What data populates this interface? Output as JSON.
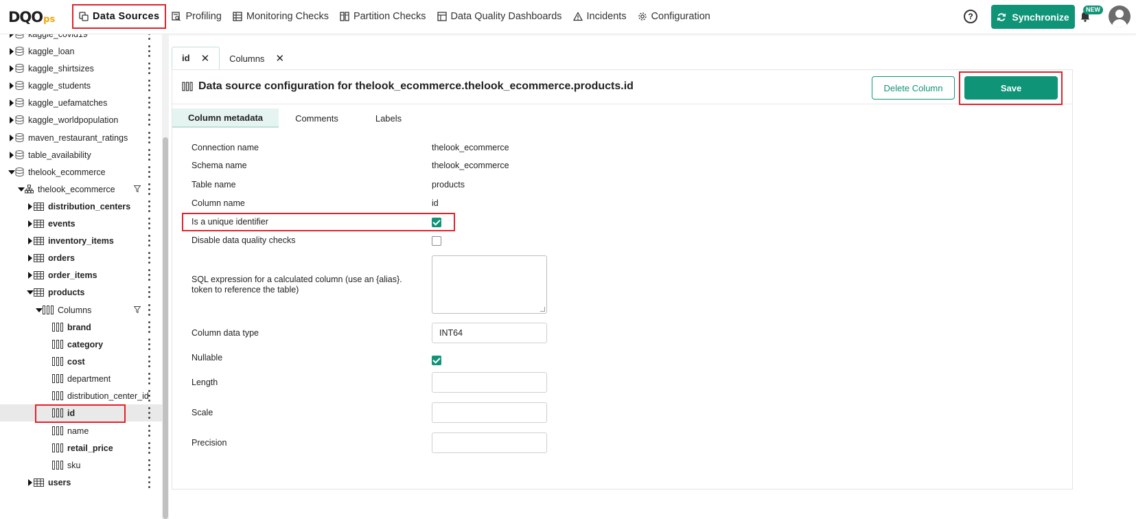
{
  "logo": {
    "main": "DQO",
    "suffix": "ps"
  },
  "nav": [
    {
      "label": "Data Sources",
      "icon": "data-sources-icon"
    },
    {
      "label": "Profiling",
      "icon": "profiling-icon"
    },
    {
      "label": "Monitoring Checks",
      "icon": "monitoring-icon"
    },
    {
      "label": "Partition Checks",
      "icon": "partition-icon"
    },
    {
      "label": "Data Quality Dashboards",
      "icon": "dashboard-icon"
    },
    {
      "label": "Incidents",
      "icon": "warning-icon"
    },
    {
      "label": "Configuration",
      "icon": "gear-icon"
    }
  ],
  "header": {
    "help": "?",
    "sync_label": "Synchronize",
    "new_badge": "NEW"
  },
  "tree": [
    {
      "label": "kaggle_covid19"
    },
    {
      "label": "kaggle_loan"
    },
    {
      "label": "kaggle_shirtsizes"
    },
    {
      "label": "kaggle_students"
    },
    {
      "label": "kaggle_uefamatches"
    },
    {
      "label": "kaggle_worldpopulation"
    },
    {
      "label": "maven_restaurant_ratings"
    },
    {
      "label": "table_availability"
    },
    {
      "label": "thelook_ecommerce"
    },
    {
      "label": "thelook_ecommerce"
    },
    {
      "label": "distribution_centers"
    },
    {
      "label": "events"
    },
    {
      "label": "inventory_items"
    },
    {
      "label": "orders"
    },
    {
      "label": "order_items"
    },
    {
      "label": "products"
    },
    {
      "label": "Columns"
    },
    {
      "label": "brand"
    },
    {
      "label": "category"
    },
    {
      "label": "cost"
    },
    {
      "label": "department"
    },
    {
      "label": "distribution_center_id"
    },
    {
      "label": "id"
    },
    {
      "label": "name"
    },
    {
      "label": "retail_price"
    },
    {
      "label": "sku"
    },
    {
      "label": "users"
    }
  ],
  "tabs": [
    {
      "label": "id",
      "close": "✕"
    },
    {
      "label": "Columns",
      "close": "✕"
    }
  ],
  "panel": {
    "title": "Data source configuration for thelook_ecommerce.thelook_ecommerce.products.id",
    "delete_label": "Delete Column",
    "save_label": "Save",
    "subtabs": [
      "Column metadata",
      "Comments",
      "Labels"
    ]
  },
  "form": {
    "connection_label": "Connection name",
    "connection_value": "thelook_ecommerce",
    "schema_label": "Schema name",
    "schema_value": "thelook_ecommerce",
    "table_label": "Table name",
    "table_value": "products",
    "column_label": "Column name",
    "column_value": "id",
    "unique_label": "Is a unique identifier",
    "unique_checked": true,
    "disable_label": "Disable data quality checks",
    "disable_checked": false,
    "sql_label": "SQL expression for a calculated column (use an {alias}. token to reference the table)",
    "sql_value": "",
    "type_label": "Column data type",
    "type_value": "INT64",
    "nullable_label": "Nullable",
    "nullable_checked": true,
    "length_label": "Length",
    "length_value": "",
    "scale_label": "Scale",
    "scale_value": "",
    "precision_label": "Precision",
    "precision_value": ""
  },
  "colors": {
    "accent": "#0f9478",
    "highlight": "#e0212b",
    "logo_suffix": "#f4a300"
  }
}
